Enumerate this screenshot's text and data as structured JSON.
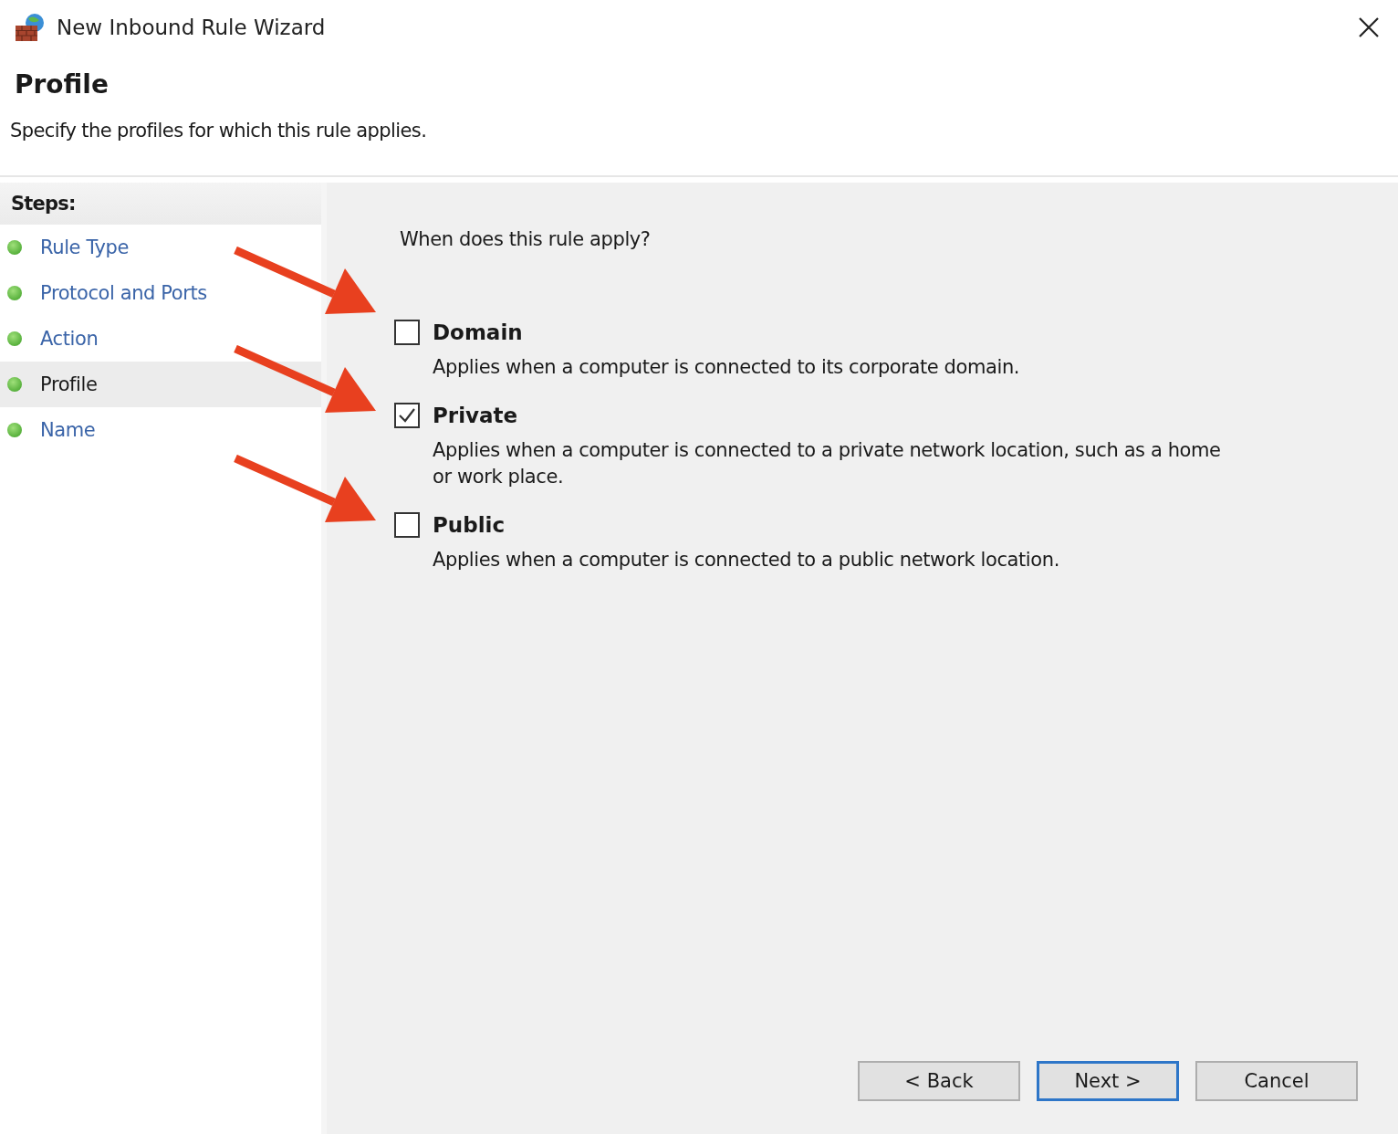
{
  "window": {
    "title": "New Inbound Rule Wizard"
  },
  "header": {
    "title": "Profile",
    "subtitle": "Specify the profiles for which this rule applies."
  },
  "steps": {
    "heading": "Steps:",
    "items": [
      {
        "label": "Rule Type",
        "selected": false
      },
      {
        "label": "Protocol and Ports",
        "selected": false
      },
      {
        "label": "Action",
        "selected": false
      },
      {
        "label": "Profile",
        "selected": true
      },
      {
        "label": "Name",
        "selected": false
      }
    ]
  },
  "question": "When does this rule apply?",
  "options": [
    {
      "label": "Domain",
      "description": "Applies when a computer is connected to its corporate domain.",
      "checked": false
    },
    {
      "label": "Private",
      "description": "Applies when a computer is connected to a private network location, such as a home or work place.",
      "checked": true
    },
    {
      "label": "Public",
      "description": "Applies when a computer is connected to a public network location.",
      "checked": false
    }
  ],
  "buttons": [
    {
      "label": "< Back",
      "default": false
    },
    {
      "label": "Next >",
      "default": true
    },
    {
      "label": "Cancel",
      "default": false
    }
  ]
}
